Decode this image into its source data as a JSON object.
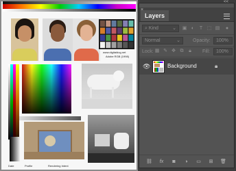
{
  "panel": {
    "collapse_glyph": "<<",
    "close_glyph": "×",
    "tab_label": "Layers",
    "filter_kind": "Kind",
    "blend_mode": "Normal",
    "opacity_label": "Opacity:",
    "opacity_value": "100%",
    "lock_label": "Lock:",
    "fill_label": "Fill:",
    "fill_value": "100%",
    "layer_name": "Background",
    "footer_icons": [
      "link-icon",
      "fx-icon",
      "mask-icon",
      "adjustment-icon",
      "folder-icon",
      "new-layer-icon",
      "trash-icon"
    ]
  },
  "document": {
    "url_text": "www.digitaldog.net",
    "profile_text": "Adobe RGB (1998)",
    "footer_labels": [
      "Date",
      "Profile",
      "Rendering Intent"
    ]
  }
}
